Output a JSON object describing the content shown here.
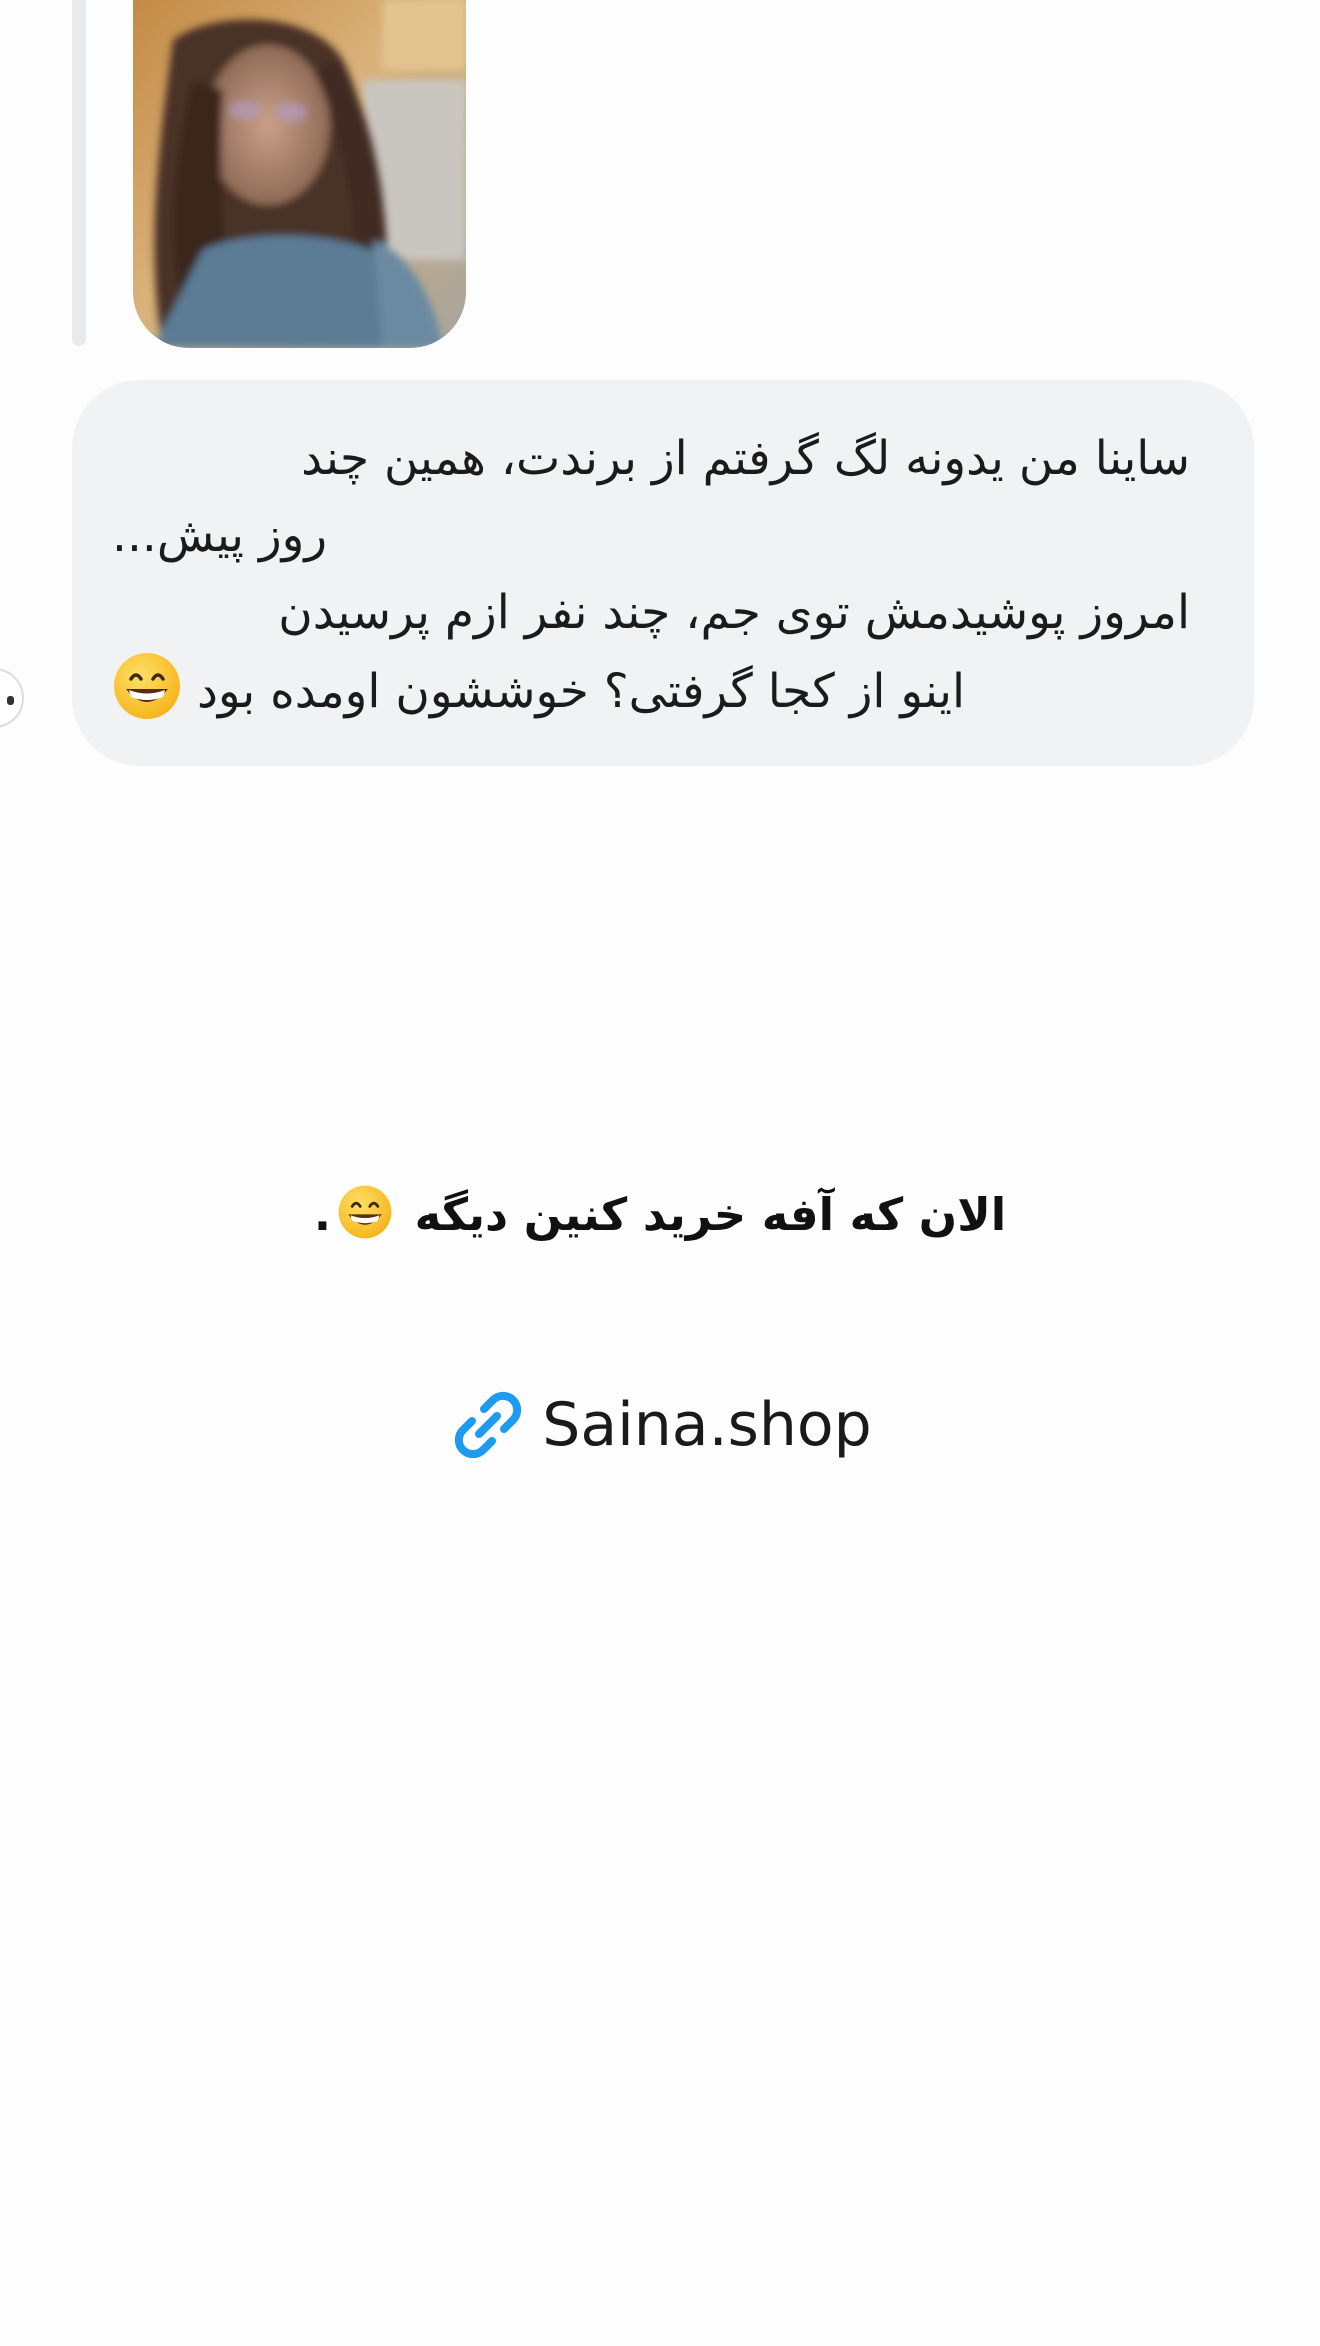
{
  "conversation": {
    "shared_photo": {
      "alt": ""
    },
    "message": {
      "lines": [
        "ساینا من یدونه لگ گرفتم از برندت، همین چند",
        "روز پیش...",
        "امروز پوشیدمش توی جم، چند نفر ازم پرسیدن",
        "اینو از کجا گرفتی؟ خوششون اومده بود"
      ],
      "emoji": "grinning-face"
    },
    "reaction": {
      "icon": "reaction-icon"
    }
  },
  "caption": {
    "text": "الان که آفه خرید کنین دیگه",
    "emoji": "grinning-face",
    "trailing": "."
  },
  "link": {
    "icon": "link-icon",
    "text": "Saina.shop",
    "color": "#1d9bf0"
  },
  "colors": {
    "background": "#fdfdfd",
    "bubble": "#f1f2f4",
    "text": "#1b1b1b",
    "accent": "#1d9bf0"
  }
}
